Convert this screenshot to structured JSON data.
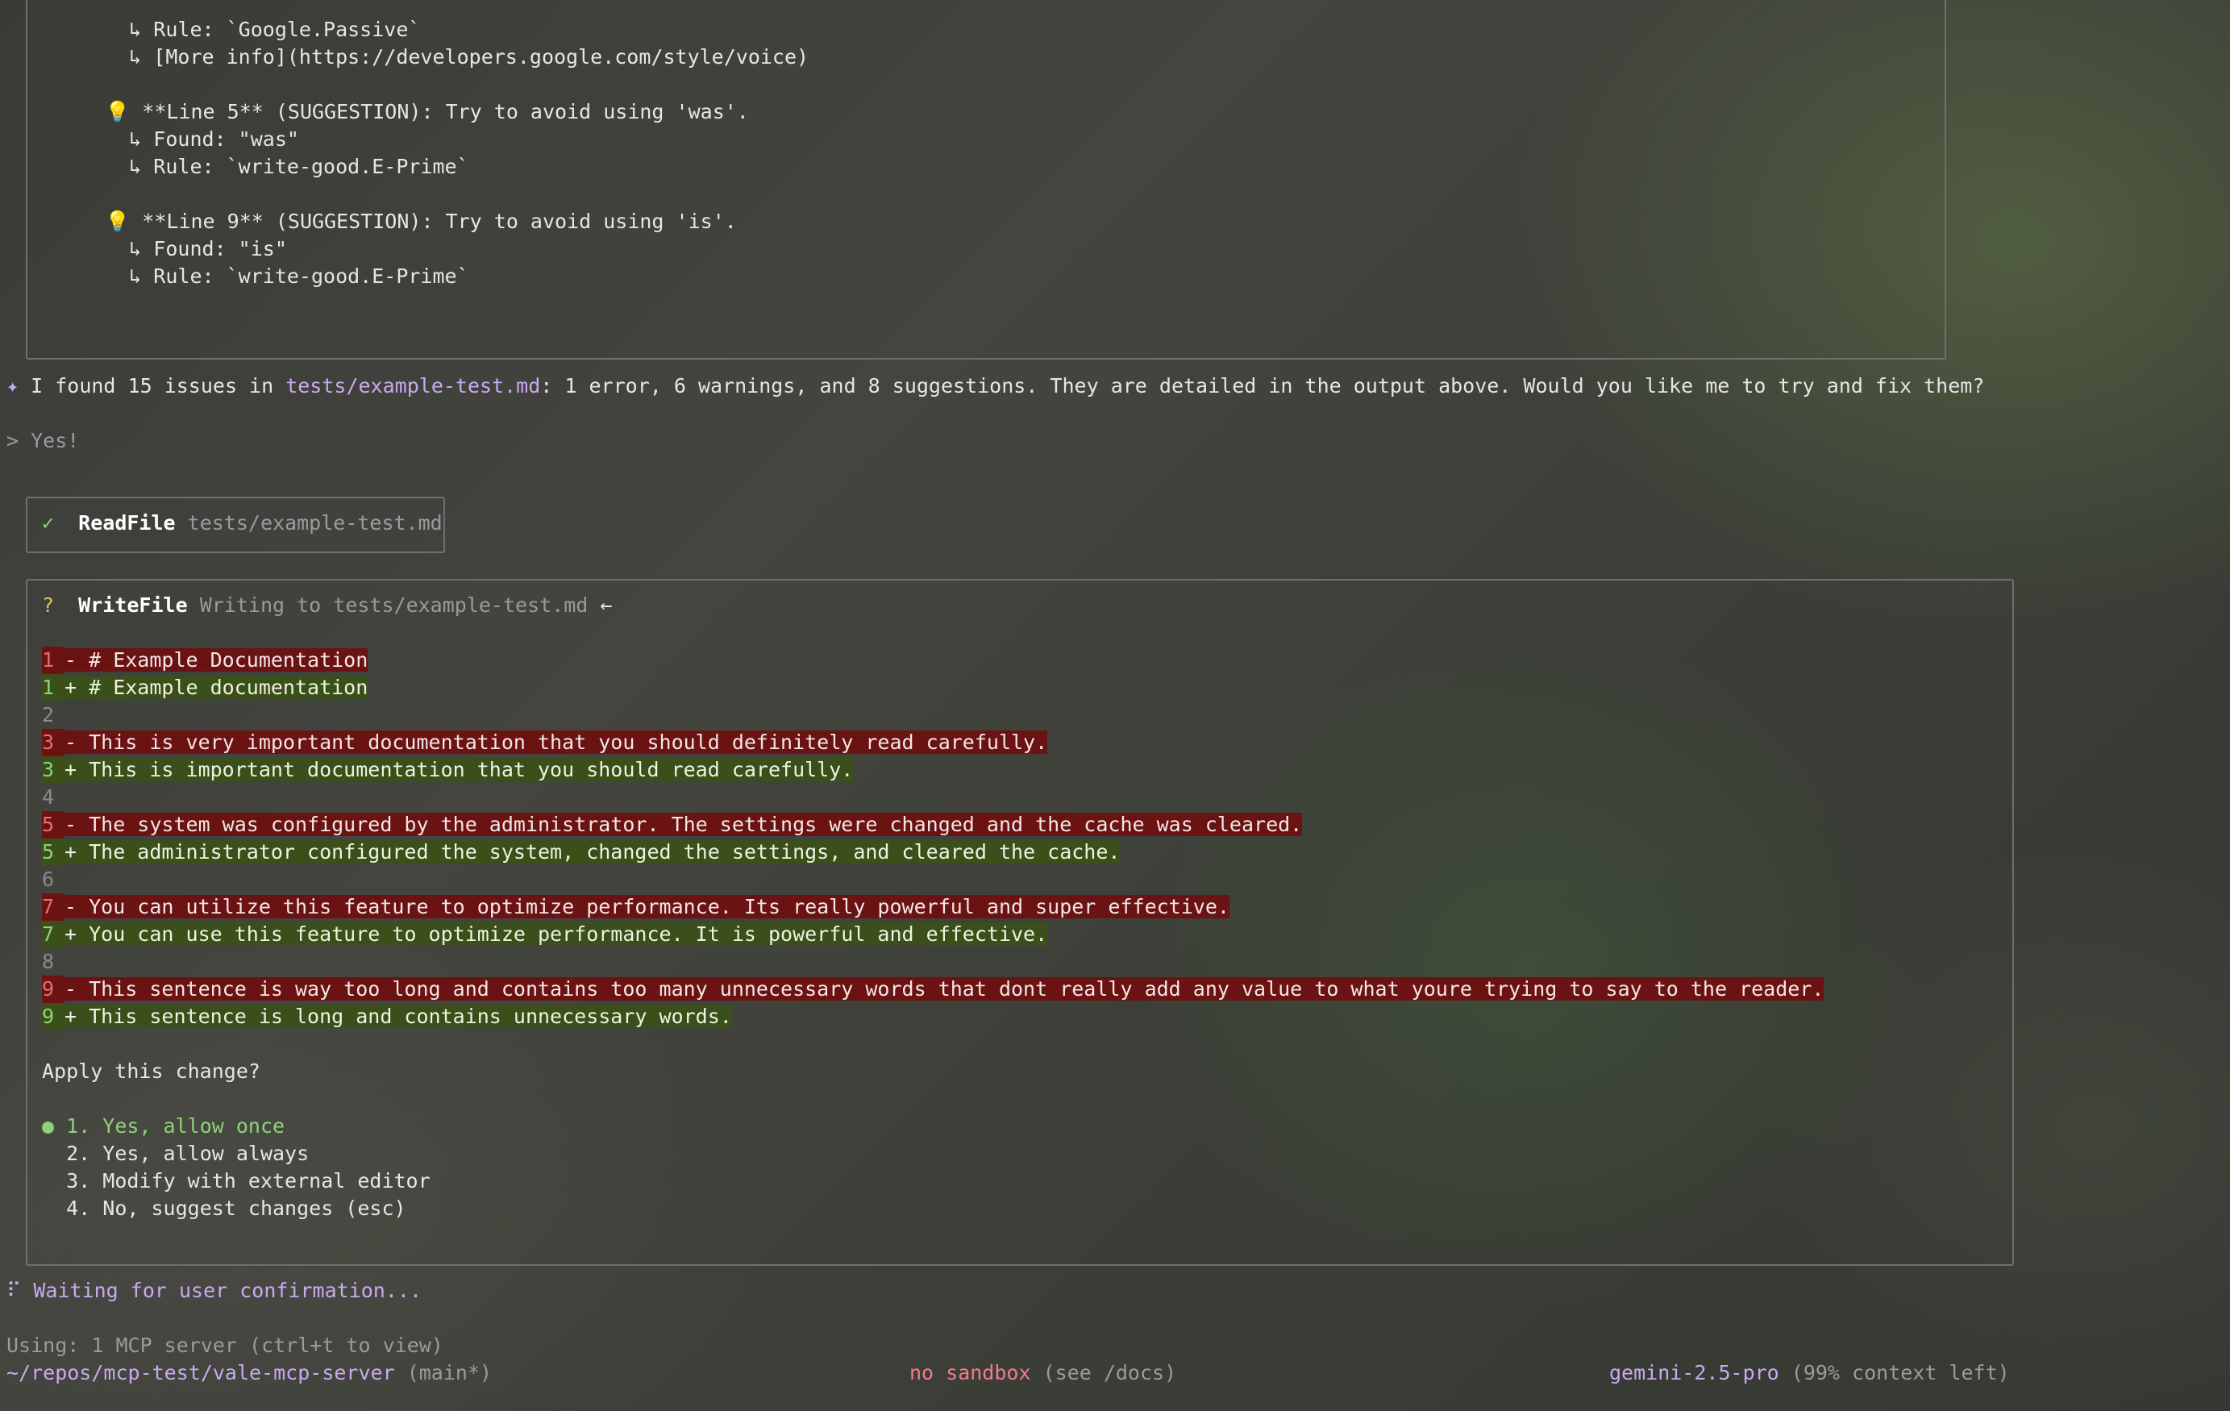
{
  "previous_output": {
    "lines": [
      "    ↳ Rule: `Google.Passive`",
      "    ↳ [More info](https://developers.google.com/style/voice)",
      "",
      "  💡 **Line 5** (SUGGESTION): Try to avoid using 'was'.",
      "    ↳ Found: \"was\"",
      "    ↳ Rule: `write-good.E-Prime`",
      "",
      "  💡 **Line 9** (SUGGESTION): Try to avoid using 'is'.",
      "    ↳ Found: \"is\"",
      "    ↳ Rule: `write-good.E-Prime`"
    ]
  },
  "assistant_message": {
    "prefix_icon": "✦",
    "text_before": "I found 15 issues in ",
    "file_link": "tests/example-test.md",
    "text_after": ": 1 error, 6 warnings, and 8 suggestions. They are detailed in the output above. Would you like me to try and fix them?"
  },
  "user_message": {
    "prompt": ">",
    "text": "Yes!"
  },
  "readfile_tool": {
    "status_icon": "✓",
    "name": "ReadFile",
    "arg": "tests/example-test.md"
  },
  "writefile_tool": {
    "status_icon": "?",
    "name": "WriteFile",
    "arg": "Writing to tests/example-test.md",
    "arrow": "←",
    "diff": [
      {
        "num": "1",
        "type": "del",
        "text": "- # Example Documentation"
      },
      {
        "num": "1",
        "type": "add",
        "text": "+ # Example documentation"
      },
      {
        "num": "2",
        "type": "ctx",
        "text": ""
      },
      {
        "num": "3",
        "type": "del",
        "text": "- This is very important documentation that you should definitely read carefully."
      },
      {
        "num": "3",
        "type": "add",
        "text": "+ This is important documentation that you should read carefully."
      },
      {
        "num": "4",
        "type": "ctx",
        "text": ""
      },
      {
        "num": "5",
        "type": "del",
        "text": "- The system was configured by the administrator. The settings were changed and the cache was cleared."
      },
      {
        "num": "5",
        "type": "add",
        "text": "+ The administrator configured the system, changed the settings, and cleared the cache."
      },
      {
        "num": "6",
        "type": "ctx",
        "text": ""
      },
      {
        "num": "7",
        "type": "del",
        "text": "- You can utilize this feature to optimize performance. Its really powerful and super effective."
      },
      {
        "num": "7",
        "type": "add",
        "text": "+ You can use this feature to optimize performance. It is powerful and effective."
      },
      {
        "num": "8",
        "type": "ctx",
        "text": ""
      },
      {
        "num": "9",
        "type": "del",
        "text": "- This sentence is way too long and contains too many unnecessary words that dont really add any value to what youre trying to say to the reader."
      },
      {
        "num": "9",
        "type": "add",
        "text": "+ This sentence is long and contains unnecessary words."
      }
    ],
    "question": "Apply this change?",
    "options": [
      {
        "bullet": "●",
        "label": "1. Yes, allow once",
        "selected": true
      },
      {
        "bullet": " ",
        "label": "2. Yes, allow always",
        "selected": false
      },
      {
        "bullet": " ",
        "label": "3. Modify with external editor",
        "selected": false
      },
      {
        "bullet": " ",
        "label": "4. No, suggest changes (esc)",
        "selected": false
      }
    ]
  },
  "status": {
    "spinner": "⠏",
    "text": "Waiting for user confirmation..."
  },
  "footer": {
    "mcp_info": "Using: 1 MCP server (ctrl+t to view)",
    "path": "~/repos/mcp-test/vale-mcp-server",
    "branch": "(main*)",
    "sandbox": "no sandbox",
    "sandbox_hint": "(see /docs)",
    "model": "gemini-2.5-pro",
    "context": "(99% context left)"
  },
  "colors": {
    "purple": "#c9a9f0",
    "deletion_bg": "#6b1212",
    "addition_bg": "#3a4f1a",
    "selected_green": "#8fd27a",
    "sandbox_pink": "#ef7d8e"
  }
}
